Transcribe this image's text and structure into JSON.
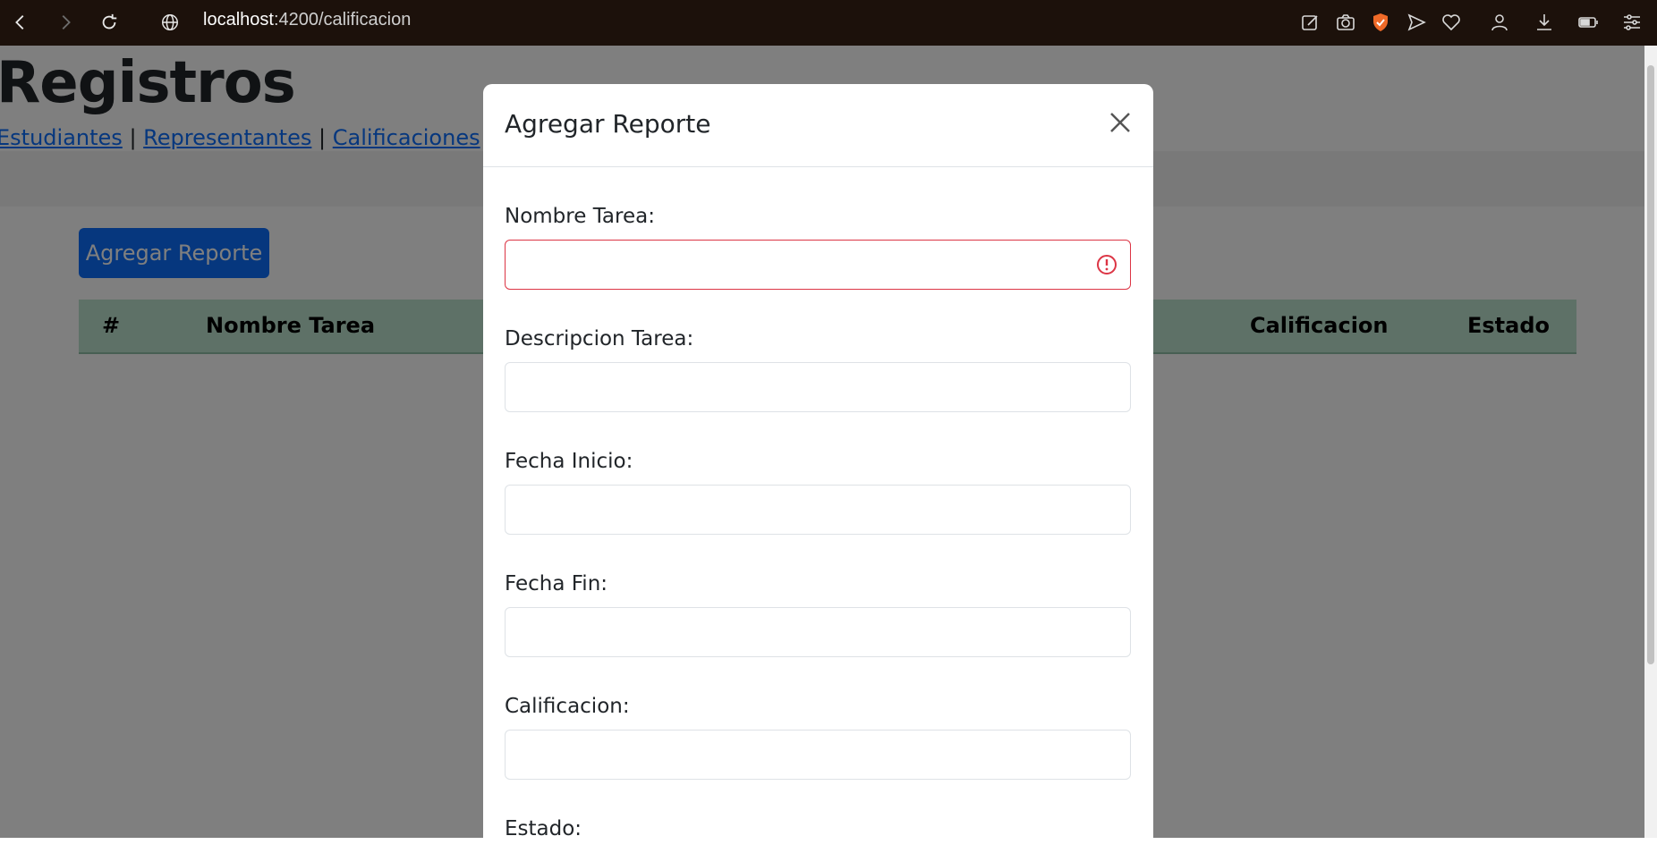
{
  "browser": {
    "url_host": "localhost",
    "url_path": ":4200/calificacion"
  },
  "page": {
    "title": "Registros",
    "nav_links": [
      "Estudiantes",
      "Representantes",
      "Calificaciones"
    ],
    "separator": "|",
    "add_button": "Agregar Reporte",
    "table_headers": {
      "num": "#",
      "nombre": "Nombre Tarea",
      "calificacion": "Calificacion",
      "estado": "Estado"
    }
  },
  "modal": {
    "title": "Agregar Reporte",
    "fields": [
      {
        "label": "Nombre Tarea:",
        "value": "",
        "invalid": true
      },
      {
        "label": "Descripcion Tarea:",
        "value": ""
      },
      {
        "label": "Fecha Inicio:",
        "value": ""
      },
      {
        "label": "Fecha Fin:",
        "value": ""
      },
      {
        "label": "Calificacion:",
        "value": ""
      },
      {
        "label": "Estado:",
        "value": ""
      }
    ]
  },
  "colors": {
    "primary": "#0d6efd",
    "danger": "#dc3545",
    "table_header": "#bde3cf",
    "chrome_bg": "#1c110b"
  }
}
